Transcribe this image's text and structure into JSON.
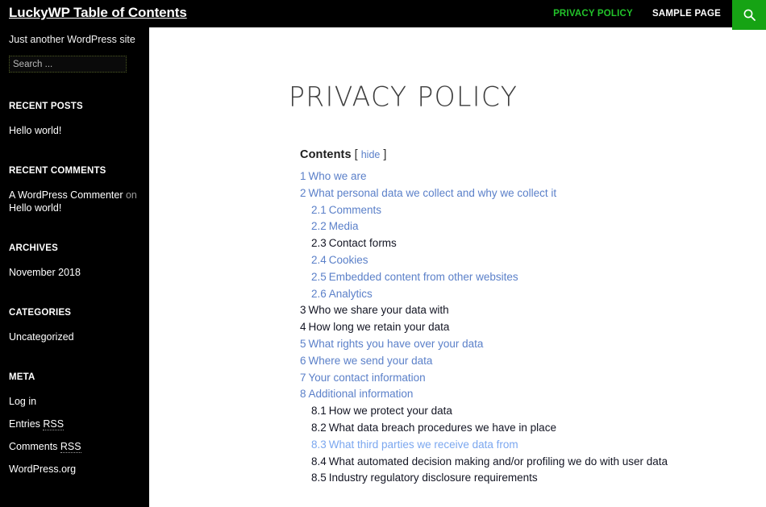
{
  "header": {
    "site_title": "LuckyWP Table of Contents",
    "nav": [
      {
        "label": "PRIVACY POLICY",
        "state": "current"
      },
      {
        "label": "SAMPLE PAGE",
        "state": "default"
      }
    ],
    "search_toggle_icon": "search-icon",
    "accent_green": "#16a314",
    "current_link_green": "#22c32a"
  },
  "sidebar": {
    "site_description": "Just another WordPress site",
    "search": {
      "placeholder": "Search ...",
      "value": ""
    },
    "widgets": [
      {
        "title": "RECENT POSTS",
        "items": [
          {
            "text": "Hello world!"
          }
        ]
      },
      {
        "title": "RECENT COMMENTS",
        "items": [
          {
            "author": "A WordPress Commenter",
            "joiner": "on",
            "post": "Hello world!"
          }
        ]
      },
      {
        "title": "ARCHIVES",
        "items": [
          {
            "text": "November 2018"
          }
        ]
      },
      {
        "title": "CATEGORIES",
        "items": [
          {
            "text": "Uncategorized"
          }
        ]
      },
      {
        "title": "META",
        "items": [
          {
            "text": "Log in"
          },
          {
            "text": "Entries ",
            "abbr": "RSS"
          },
          {
            "text": "Comments ",
            "abbr": "RSS"
          },
          {
            "text": "WordPress.org"
          }
        ]
      }
    ]
  },
  "main": {
    "page_title": "PRIVACY POLICY",
    "toc": {
      "label": "Contents",
      "bracket_open": "[",
      "bracket_close": "]",
      "toggle_label": "hide",
      "link_color": "#5b80c9",
      "visited_color": "#131523",
      "hover_color": "#7ba7ef",
      "items": [
        {
          "num": "1",
          "title": "Who we are",
          "state": "default"
        },
        {
          "num": "2",
          "title": "What personal data we collect and why we collect it",
          "state": "default",
          "children": [
            {
              "num": "2.1",
              "title": "Comments",
              "state": "default"
            },
            {
              "num": "2.2",
              "title": "Media",
              "state": "default"
            },
            {
              "num": "2.3",
              "title": "Contact forms",
              "state": "visited"
            },
            {
              "num": "2.4",
              "title": "Cookies",
              "state": "default"
            },
            {
              "num": "2.5",
              "title": "Embedded content from other websites",
              "state": "default"
            },
            {
              "num": "2.6",
              "title": "Analytics",
              "state": "default"
            }
          ]
        },
        {
          "num": "3",
          "title": "Who we share your data with",
          "state": "visited"
        },
        {
          "num": "4",
          "title": "How long we retain your data",
          "state": "visited"
        },
        {
          "num": "5",
          "title": "What rights you have over your data",
          "state": "default"
        },
        {
          "num": "6",
          "title": "Where we send your data",
          "state": "default"
        },
        {
          "num": "7",
          "title": "Your contact information",
          "state": "default"
        },
        {
          "num": "8",
          "title": "Additional information",
          "state": "default",
          "children": [
            {
              "num": "8.1",
              "title": "How we protect your data",
              "state": "visited"
            },
            {
              "num": "8.2",
              "title": "What data breach procedures we have in place",
              "state": "visited"
            },
            {
              "num": "8.3",
              "title": "What third parties we receive data from",
              "state": "hovered"
            },
            {
              "num": "8.4",
              "title": "What automated decision making and/or profiling we do with user data",
              "state": "visited"
            },
            {
              "num": "8.5",
              "title": "Industry regulatory disclosure requirements",
              "state": "visited"
            }
          ]
        }
      ]
    }
  }
}
